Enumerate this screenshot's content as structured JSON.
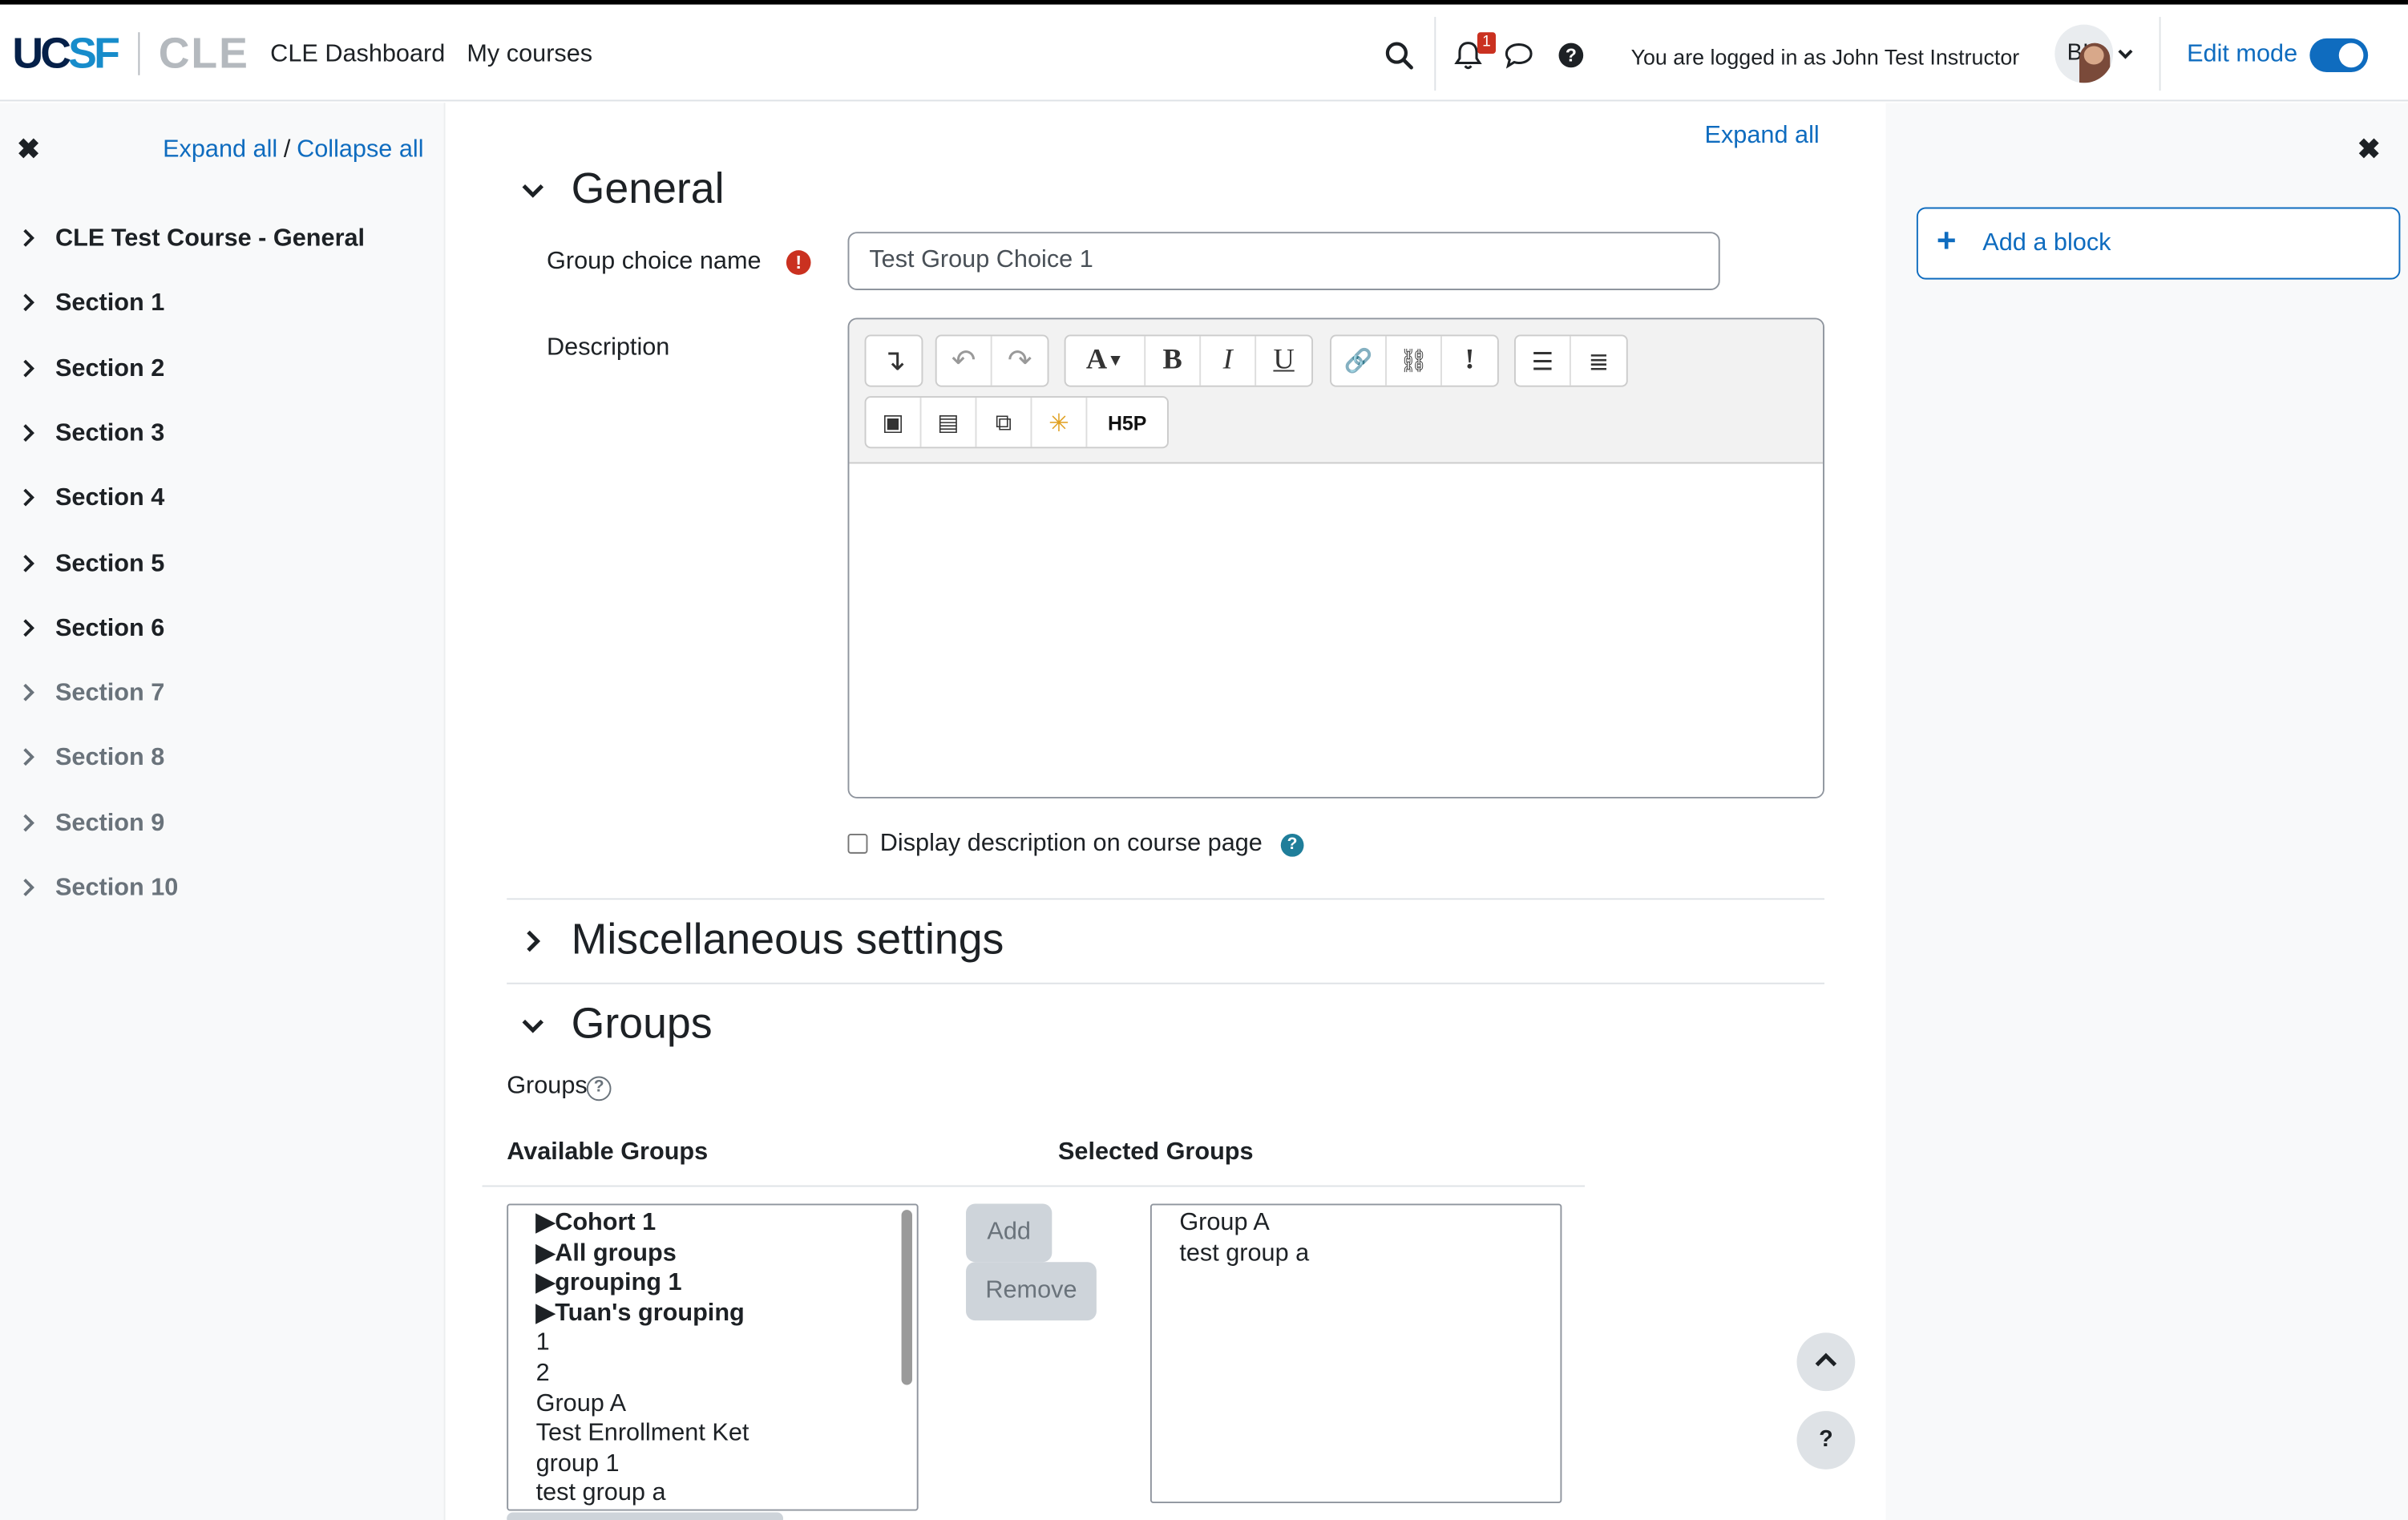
{
  "navbar": {
    "brand_ucsf": "UCSF",
    "brand_cle": "CLE",
    "links": [
      "CLE Dashboard",
      "My courses"
    ],
    "notification_count": "1",
    "logged_in_text": "You are logged in as John Test Instructor",
    "avatar_initials": "BI",
    "edit_mode_label": "Edit mode",
    "edit_mode_on": true
  },
  "course_index": {
    "expand_all": "Expand all",
    "separator": "/",
    "collapse_all": "Collapse all",
    "sections": [
      "CLE Test Course - General",
      "Section 1",
      "Section 2",
      "Section 3",
      "Section 4",
      "Section 5",
      "Section 6",
      "Section 7",
      "Section 8",
      "Section 9",
      "Section 10"
    ]
  },
  "form": {
    "expand_all": "Expand all",
    "general": {
      "heading": "General",
      "name_label": "Group choice name",
      "name_value": "Test Group Choice 1",
      "description_label": "Description",
      "display_description_label": "Display description on course page",
      "display_description_checked": false
    },
    "misc": {
      "heading": "Miscellaneous settings"
    },
    "groups": {
      "heading": "Groups",
      "field_label": "Groups",
      "available_heading": "Available Groups",
      "selected_heading": "Selected Groups",
      "available_items": [
        {
          "text": "▶Cohort 1",
          "bold": true
        },
        {
          "text": "▶All groups",
          "bold": true
        },
        {
          "text": "▶grouping 1",
          "bold": true
        },
        {
          "text": "▶Tuan's grouping",
          "bold": true
        },
        {
          "text": "1",
          "bold": false
        },
        {
          "text": "2",
          "bold": false
        },
        {
          "text": "Group A",
          "bold": false
        },
        {
          "text": "Test Enrollment Ket",
          "bold": false
        },
        {
          "text": "group 1",
          "bold": false
        },
        {
          "text": "test group a",
          "bold": false
        }
      ],
      "selected_items": [
        "Group A",
        "test group a"
      ],
      "add_label": "Add",
      "remove_label": "Remove"
    }
  },
  "block_drawer": {
    "add_block_label": "Add a block"
  },
  "colors": {
    "link": "#0f6cbf",
    "required": "#ca3120",
    "help": "#1f7e9a"
  }
}
